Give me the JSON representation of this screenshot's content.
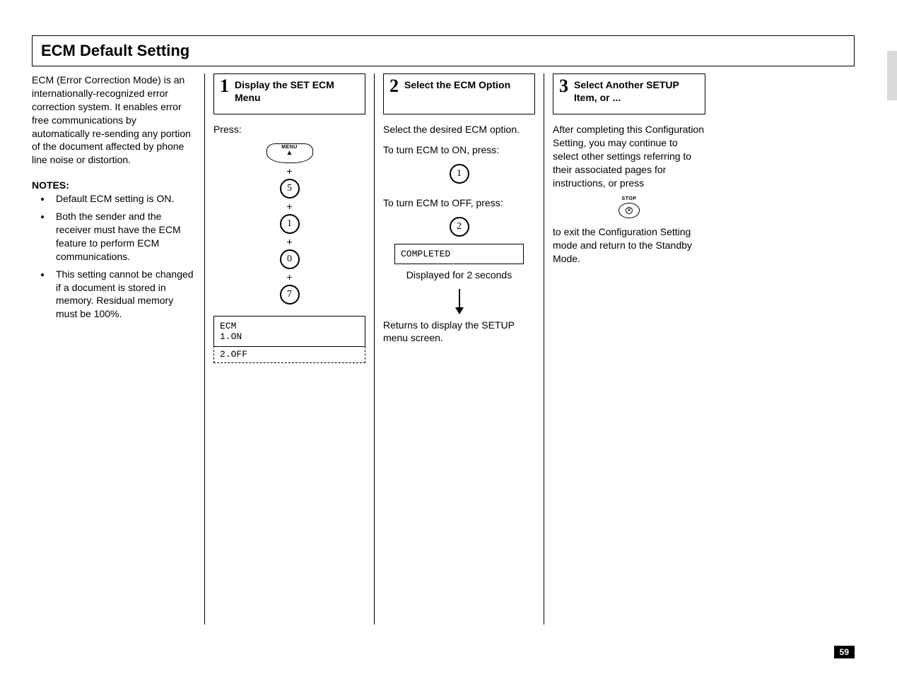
{
  "page": {
    "title": "ECM Default Setting",
    "intro": "ECM (Error Correction Mode) is an internationally-recognized error correction system. It enables error free communications by automatically re-sending any portion of the document affected by phone line noise or distortion.",
    "notes_heading": "NOTES:",
    "notes": [
      "Default ECM setting is ON.",
      "Both the sender and the receiver must have the ECM feature to perform ECM communications.",
      "This setting cannot be changed if a document is stored in memory. Residual memory must be 100%."
    ],
    "page_number": "59"
  },
  "steps": {
    "s1": {
      "num": "1",
      "title": "Display the SET ECM Menu",
      "press": "Press:",
      "menu_label": "MENU",
      "keys": [
        "5",
        "1",
        "0",
        "7"
      ],
      "plus": "+",
      "lcd_line1": "ECM",
      "lcd_line2": "1.ON",
      "lcd_line3": "2.OFF"
    },
    "s2": {
      "num": "2",
      "title": "Select the ECM Option",
      "intro": "Select the desired ECM option.",
      "on_text": "To turn ECM to ON, press:",
      "on_key": "1",
      "off_text": "To turn ECM to OFF, press:",
      "off_key": "2",
      "completed": "COMPLETED",
      "displayed": "Displayed for 2 seconds",
      "returns": "Returns to display the SETUP menu screen."
    },
    "s3": {
      "num": "3",
      "title": "Select Another SETUP Item, or ...",
      "para1": "After completing this Configuration Setting, you may continue to select other settings referring to their associated pages for instructions, or press",
      "stop_label": "STOP",
      "para2": "to exit the Configuration Setting mode and return to the Standby Mode."
    }
  }
}
